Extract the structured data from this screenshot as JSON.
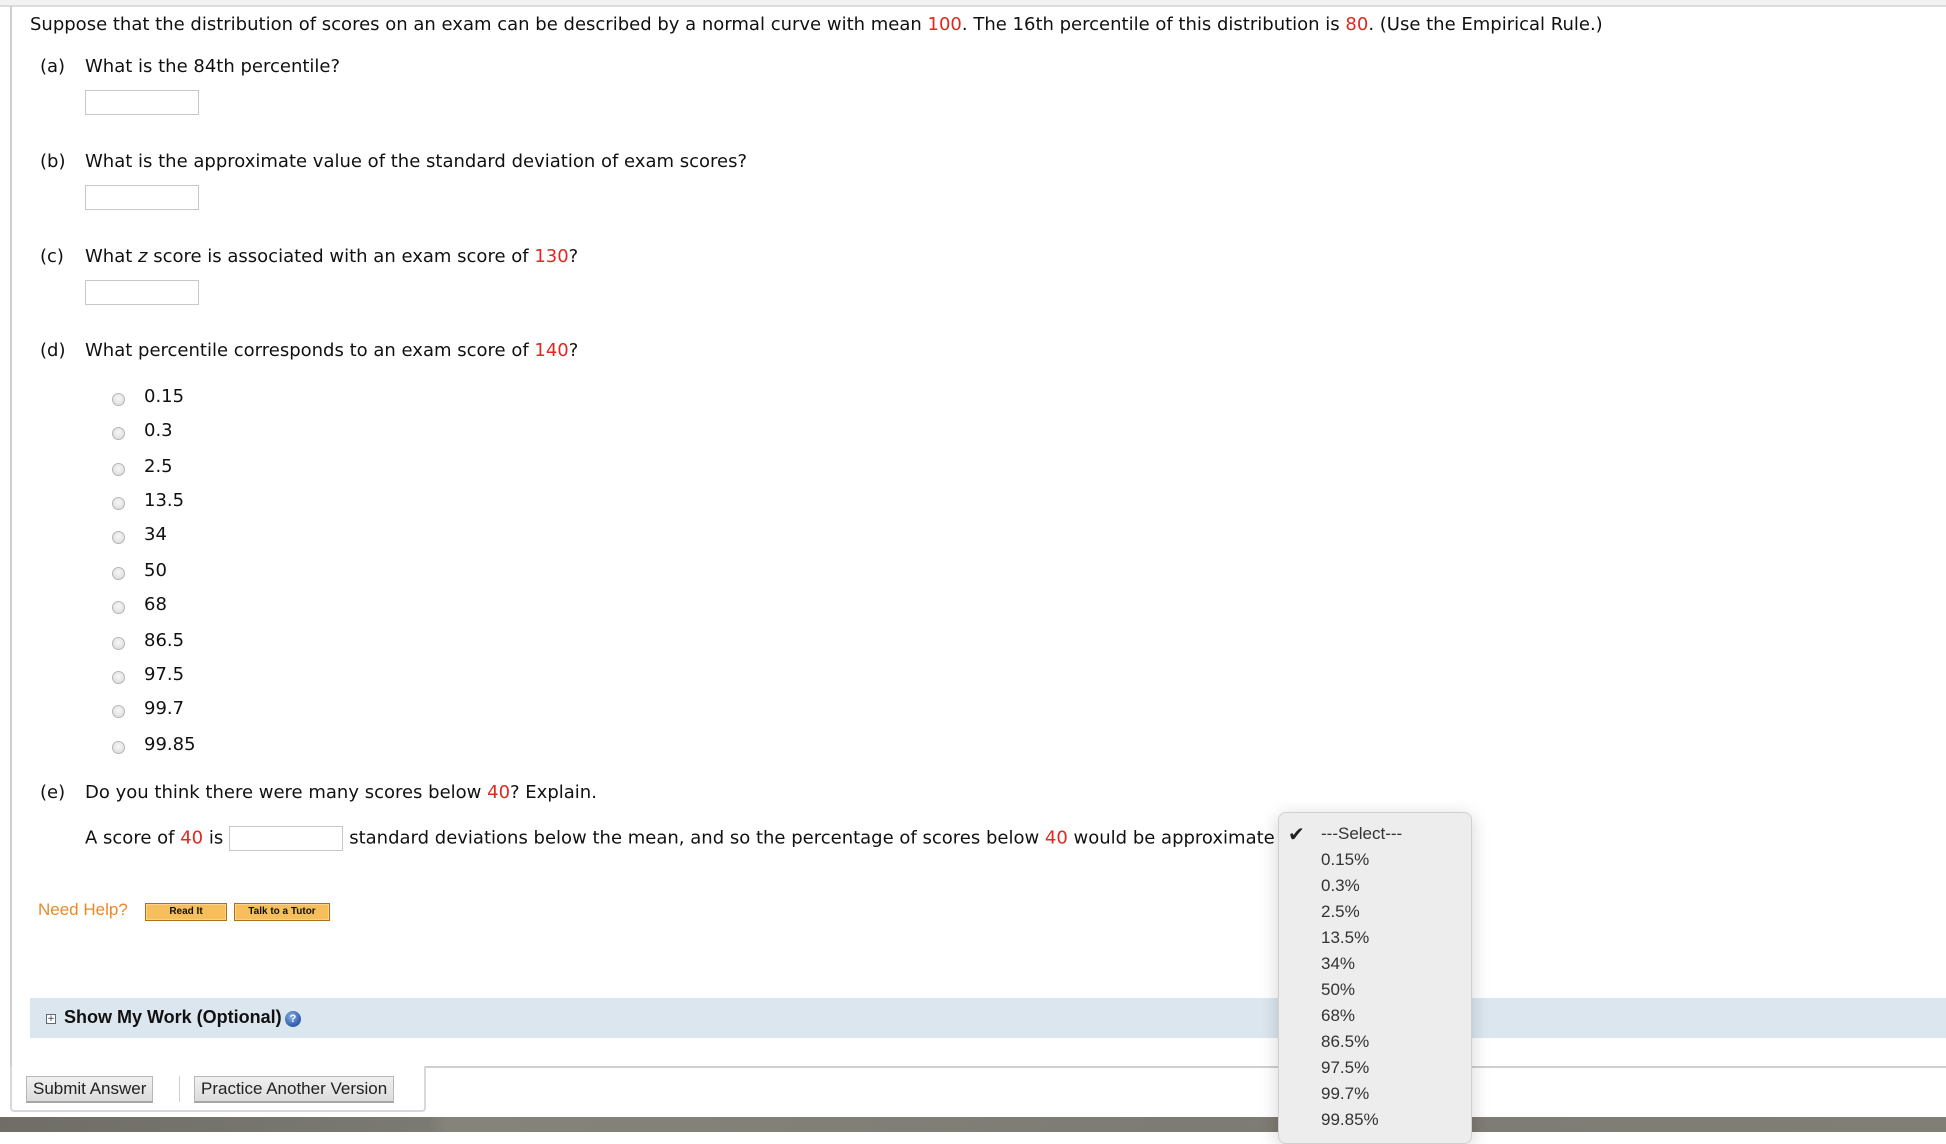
{
  "intro": {
    "part1": "Suppose that the distribution of scores on an exam can be described by a normal curve with mean ",
    "mean": "100",
    "part2": ". The 16th percentile of this distribution is ",
    "p16": "80",
    "part3": ". (Use the Empirical Rule.)"
  },
  "parts": {
    "a": {
      "label": "(a)",
      "question": "What is the 84th percentile?",
      "answer": ""
    },
    "b": {
      "label": "(b)",
      "question": "What is the approximate value of the standard deviation of exam scores?",
      "answer": ""
    },
    "c": {
      "label": "(c)",
      "q_pre": "What ",
      "q_var": "z",
      "q_mid": " score is associated with an exam score of ",
      "q_val": "130",
      "q_post": "?",
      "answer": ""
    },
    "d": {
      "label": "(d)",
      "q_pre": "What percentile corresponds to an exam score of ",
      "q_val": "140",
      "q_post": "?",
      "options": [
        "0.15",
        "0.3",
        "2.5",
        "13.5",
        "34",
        "50",
        "68",
        "86.5",
        "97.5",
        "99.7",
        "99.85"
      ],
      "selected": null
    },
    "e": {
      "label": "(e)",
      "q_pre": "Do you think there were many scores below ",
      "q_val": "40",
      "q_post": "? Explain.",
      "s_pre": "A score of ",
      "s_val": "40",
      "s_mid": " is",
      "s_after_input": "standard deviations below the mean, and so the percentage of scores below ",
      "s_val2": "40",
      "s_end": " would be approximate",
      "answer": ""
    }
  },
  "dropdown": {
    "selected": "---Select---",
    "options": [
      "---Select---",
      "0.15%",
      "0.3%",
      "2.5%",
      "13.5%",
      "34%",
      "50%",
      "68%",
      "86.5%",
      "97.5%",
      "99.7%",
      "99.85%"
    ],
    "check_icon": "checkmark-icon"
  },
  "help": {
    "label": "Need Help?",
    "read_it": "Read It",
    "tutor": "Talk to a Tutor"
  },
  "show_my_work": {
    "label": "Show My Work (Optional)",
    "expand_icon": "plus-square-icon",
    "help_icon": "question-circle-icon",
    "help_glyph": "?",
    "expand_glyph": "+"
  },
  "footer": {
    "submit": "Submit Answer",
    "practice": "Practice Another Version"
  },
  "colors": {
    "highlight_red": "#e0281e",
    "help_orange": "#e8892b",
    "button_orange": "#f6bf5c",
    "band_blue": "#dce6ef"
  }
}
